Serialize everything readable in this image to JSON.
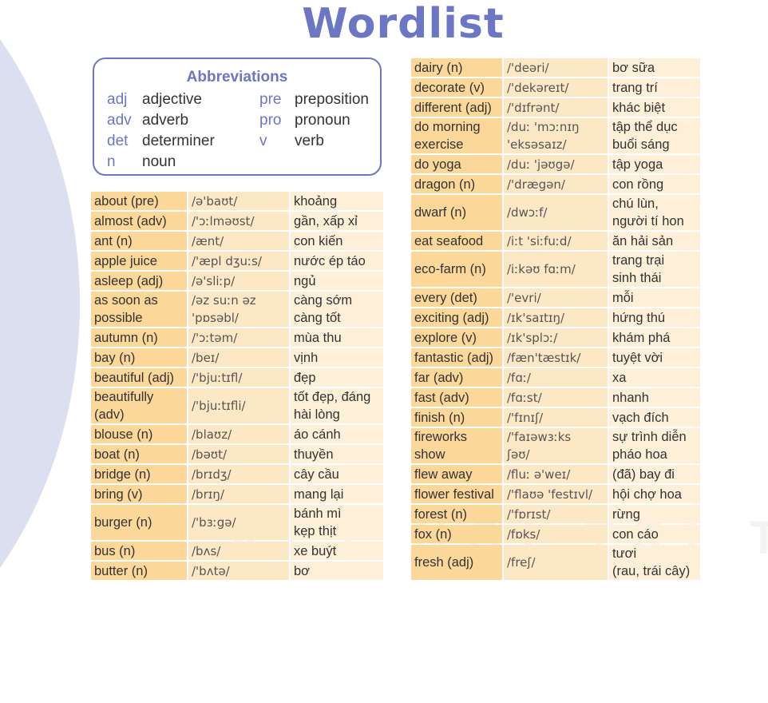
{
  "page": {
    "title": "Wordlist",
    "watermark": "KẾT NỐI TRI THỨC",
    "accent_color": "#6b76c4"
  },
  "abbreviations": {
    "title": "Abbreviations",
    "items": [
      {
        "abbr": "adj",
        "meaning": "adjective"
      },
      {
        "abbr": "adv",
        "meaning": "adverb"
      },
      {
        "abbr": "det",
        "meaning": "determiner"
      },
      {
        "abbr": "n",
        "meaning": "noun"
      },
      {
        "abbr": "pre",
        "meaning": "preposition"
      },
      {
        "abbr": "pro",
        "meaning": "pronoun"
      },
      {
        "abbr": "v",
        "meaning": "verb"
      }
    ]
  },
  "left_table": [
    {
      "word": "about (pre)",
      "ipa": "/ə'baʊt/",
      "meaning": "khoảng"
    },
    {
      "word": "almost (adv)",
      "ipa": "/'ɔːlməʊst/",
      "meaning": "gần, xấp xỉ"
    },
    {
      "word": "ant (n)",
      "ipa": "/ænt/",
      "meaning": "con kiến"
    },
    {
      "word": "apple juice",
      "ipa": "/'æpl dʒuːs/",
      "meaning": "nước ép táo"
    },
    {
      "word": "asleep (adj)",
      "ipa": "/ə'sliːp/",
      "meaning": "ngủ"
    },
    {
      "word": "as soon as\npossible",
      "ipa": "/əz suːn əz\n'pɒsəbl/",
      "meaning": "càng sớm\ncàng tốt"
    },
    {
      "word": "autumn (n)",
      "ipa": "/'ɔːtəm/",
      "meaning": "mùa thu"
    },
    {
      "word": "bay (n)",
      "ipa": "/beɪ/",
      "meaning": "vịnh"
    },
    {
      "word": "beautiful (adj)",
      "ipa": "/'bjuːtɪfl/",
      "meaning": "đẹp"
    },
    {
      "word": "beautifully (adv)",
      "ipa": "/'bjuːtɪfli/",
      "meaning": "tốt đẹp, đáng\nhài lòng"
    },
    {
      "word": "blouse (n)",
      "ipa": "/blaʊz/",
      "meaning": "áo cánh"
    },
    {
      "word": "boat (n)",
      "ipa": "/bəʊt/",
      "meaning": "thuyền"
    },
    {
      "word": "bridge (n)",
      "ipa": "/brɪdʒ/",
      "meaning": "cây cầu"
    },
    {
      "word": "bring (v)",
      "ipa": "/brɪŋ/",
      "meaning": "mang lại"
    },
    {
      "word": "burger (n)",
      "ipa": "/'bɜːgə/",
      "meaning": "bánh mì\nkẹp thịt"
    },
    {
      "word": "bus (n)",
      "ipa": "/bʌs/",
      "meaning": "xe buýt"
    },
    {
      "word": "butter (n)",
      "ipa": "/'bʌtə/",
      "meaning": "bơ"
    }
  ],
  "right_table": [
    {
      "word": "dairy (n)",
      "ipa": "/'deəri/",
      "meaning": "bơ sữa"
    },
    {
      "word": "decorate (v)",
      "ipa": "/'dekəreɪt/",
      "meaning": "trang trí"
    },
    {
      "word": "different (adj)",
      "ipa": "/'dɪfrənt/",
      "meaning": "khác biệt"
    },
    {
      "word": "do morning\nexercise",
      "ipa": "/duː 'mɔːnɪŋ\n'eksəsaɪz/",
      "meaning": "tập thể dục\nbuổi sáng"
    },
    {
      "word": "do yoga",
      "ipa": "/duː 'jəʊgə/",
      "meaning": "tập yoga"
    },
    {
      "word": "dragon (n)",
      "ipa": "/'drægən/",
      "meaning": "con rồng"
    },
    {
      "word": "dwarf (n)",
      "ipa": "/dwɔːf/",
      "meaning": "chú lùn,\nngười tí hon"
    },
    {
      "word": "eat seafood",
      "ipa": "/iːt 'siːfuːd/",
      "meaning": "ăn hải sản"
    },
    {
      "word": "eco-farm (n)",
      "ipa": "/iːkəʊ fɑːm/",
      "meaning": "trang trại\nsinh thái"
    },
    {
      "word": "every (det)",
      "ipa": "/'evri/",
      "meaning": "mỗi"
    },
    {
      "word": "exciting (adj)",
      "ipa": "/ɪk'saɪtɪŋ/",
      "meaning": "hứng thú"
    },
    {
      "word": "explore (v)",
      "ipa": "/ɪk'splɔː/",
      "meaning": "khám phá"
    },
    {
      "word": "fantastic (adj)",
      "ipa": "/fæn'tæstɪk/",
      "meaning": "tuyệt vời"
    },
    {
      "word": "far (adv)",
      "ipa": "/fɑː/",
      "meaning": "xa"
    },
    {
      "word": "fast (adv)",
      "ipa": "/fɑːst/",
      "meaning": "nhanh"
    },
    {
      "word": "finish (n)",
      "ipa": "/'fɪnɪʃ/",
      "meaning": "vạch đích"
    },
    {
      "word": "fireworks\nshow",
      "ipa": "/'faɪəwɜːks\nʃəʊ/",
      "meaning": "sự trình diễn\npháo hoa"
    },
    {
      "word": "flew away",
      "ipa": "/fluː ə'weɪ/",
      "meaning": "(đã) bay đi"
    },
    {
      "word": "flower festival",
      "ipa": "/'flaʊə 'festɪvl/",
      "meaning": "hội chợ hoa"
    },
    {
      "word": "forest (n)",
      "ipa": "/'fɒrɪst/",
      "meaning": "rừng"
    },
    {
      "word": "fox (n)",
      "ipa": "/fɒks/",
      "meaning": "con cáo"
    },
    {
      "word": "fresh (adj)",
      "ipa": "/freʃ/",
      "meaning": "tươi\n(rau, trái cây)"
    }
  ]
}
